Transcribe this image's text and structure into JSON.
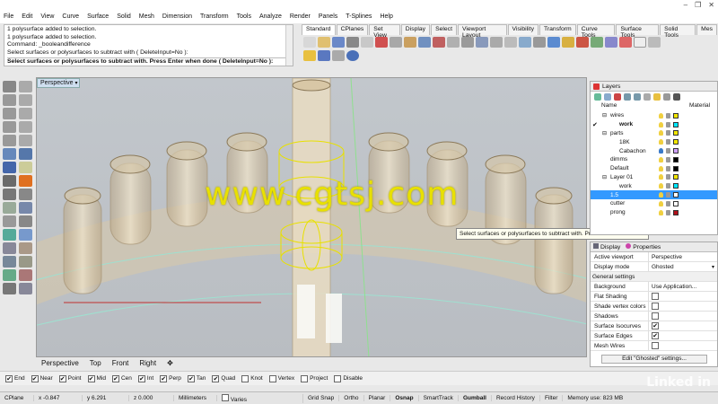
{
  "window": {
    "min": "–",
    "max": "❐",
    "close": "✕"
  },
  "menu": [
    "File",
    "Edit",
    "View",
    "Curve",
    "Surface",
    "Solid",
    "Mesh",
    "Dimension",
    "Transform",
    "Tools",
    "Analyze",
    "Render",
    "Panels",
    "T-Splines",
    "Help"
  ],
  "command_history": [
    "1 polysurface added to selection.",
    "1 polysurface added to selection.",
    "Command: _booleandifference",
    "Select surfaces or polysurfaces to subtract with ( DeleteInput=No ):"
  ],
  "command_prompt": "Select surfaces or polysurfaces to subtract with. Press Enter when done ( DeleteInput=No ):",
  "toolbar_tabs": [
    "Standard",
    "CPlanes",
    "Set View",
    "Display",
    "Select",
    "Viewport Layout",
    "Visibility",
    "Transform",
    "Curve Tools",
    "Surface Tools",
    "Solid Tools",
    "Mes"
  ],
  "viewport": {
    "label": "Perspective",
    "watermark": "www.cgtsj.com",
    "tooltip": "Select surfaces or polysurfaces to subtract with. Press Enter when done"
  },
  "viewport_tabs": [
    "Perspective",
    "Top",
    "Front",
    "Right",
    "✥"
  ],
  "osnaps": [
    {
      "label": "End",
      "checked": true
    },
    {
      "label": "Near",
      "checked": true
    },
    {
      "label": "Point",
      "checked": true
    },
    {
      "label": "Mid",
      "checked": true
    },
    {
      "label": "Cen",
      "checked": true
    },
    {
      "label": "Int",
      "checked": true
    },
    {
      "label": "Perp",
      "checked": true
    },
    {
      "label": "Tan",
      "checked": true
    },
    {
      "label": "Quad",
      "checked": true
    },
    {
      "label": "Knot",
      "checked": false
    },
    {
      "label": "Vertex",
      "checked": false
    },
    {
      "label": "Project",
      "checked": false
    },
    {
      "label": "Disable",
      "checked": false
    }
  ],
  "status": {
    "cplane": "CPlane",
    "x": "x -0.847",
    "y": "y 6.291",
    "z": "z 0.000",
    "units": "Millimeters",
    "layer": "Varies",
    "toggles": [
      "Grid Snap",
      "Ortho",
      "Planar",
      "Osnap",
      "SmartTrack",
      "Gumball",
      "Record History",
      "Filter"
    ],
    "memory": "Memory use: 823 MB"
  },
  "layers_panel": {
    "title": "Layers",
    "col_name": "Name",
    "col_material": "Material",
    "rows": [
      {
        "name": "wires",
        "indent": 22,
        "expand": "⊟",
        "check": "",
        "color": "#f2e600",
        "sel": false
      },
      {
        "name": "work",
        "indent": 32,
        "expand": "",
        "check": "✔",
        "color": "#00e8ff",
        "sel": false,
        "bold": true
      },
      {
        "name": "parts",
        "indent": 22,
        "expand": "⊟",
        "check": "",
        "color": "#f2e600",
        "sel": false
      },
      {
        "name": "18K",
        "indent": 32,
        "expand": "",
        "check": "",
        "color": "#f2e600",
        "sel": false
      },
      {
        "name": "Cabachon",
        "indent": 32,
        "expand": "",
        "check": "",
        "color": "#cfa0ff",
        "sel": false
      },
      {
        "name": "dimms",
        "indent": 22,
        "expand": "",
        "check": "",
        "color": "#000000",
        "sel": false
      },
      {
        "name": "Default",
        "indent": 22,
        "expand": "",
        "check": "",
        "color": "#000000",
        "sel": false
      },
      {
        "name": "Layer 01",
        "indent": 22,
        "expand": "⊟",
        "check": "",
        "color": "#f2e600",
        "sel": false
      },
      {
        "name": "work",
        "indent": 32,
        "expand": "",
        "check": "",
        "color": "#00e8ff",
        "sel": false
      },
      {
        "name": "1.5",
        "indent": 22,
        "expand": "",
        "check": "",
        "color": "#ffffff",
        "sel": true
      },
      {
        "name": "cutter",
        "indent": 22,
        "expand": "",
        "check": "",
        "color": "#ffffff",
        "sel": false
      },
      {
        "name": "prong",
        "indent": 22,
        "expand": "",
        "check": "",
        "color": "#b0101a",
        "sel": false
      }
    ]
  },
  "props_panel": {
    "tab_display": "Display",
    "tab_properties": "Properties",
    "rows": [
      {
        "k": "Active viewport",
        "v": "Perspective"
      },
      {
        "k": "Display mode",
        "v": "Ghosted"
      }
    ],
    "section": "General settings",
    "settings": [
      {
        "k": "Background",
        "v": "Use Application..."
      },
      {
        "k": "Flat Shading",
        "v": "",
        "checked": false
      },
      {
        "k": "Shade vertex colors",
        "v": "",
        "checked": false
      },
      {
        "k": "Shadows",
        "v": "",
        "checked": false
      },
      {
        "k": "Surface Isocurves",
        "v": "",
        "checked": true
      },
      {
        "k": "Surface Edges",
        "v": "",
        "checked": true
      },
      {
        "k": "Mesh Wires",
        "v": "",
        "checked": false
      }
    ],
    "button": "Edit \"Ghosted\" settings..."
  },
  "brand": "Linked in"
}
